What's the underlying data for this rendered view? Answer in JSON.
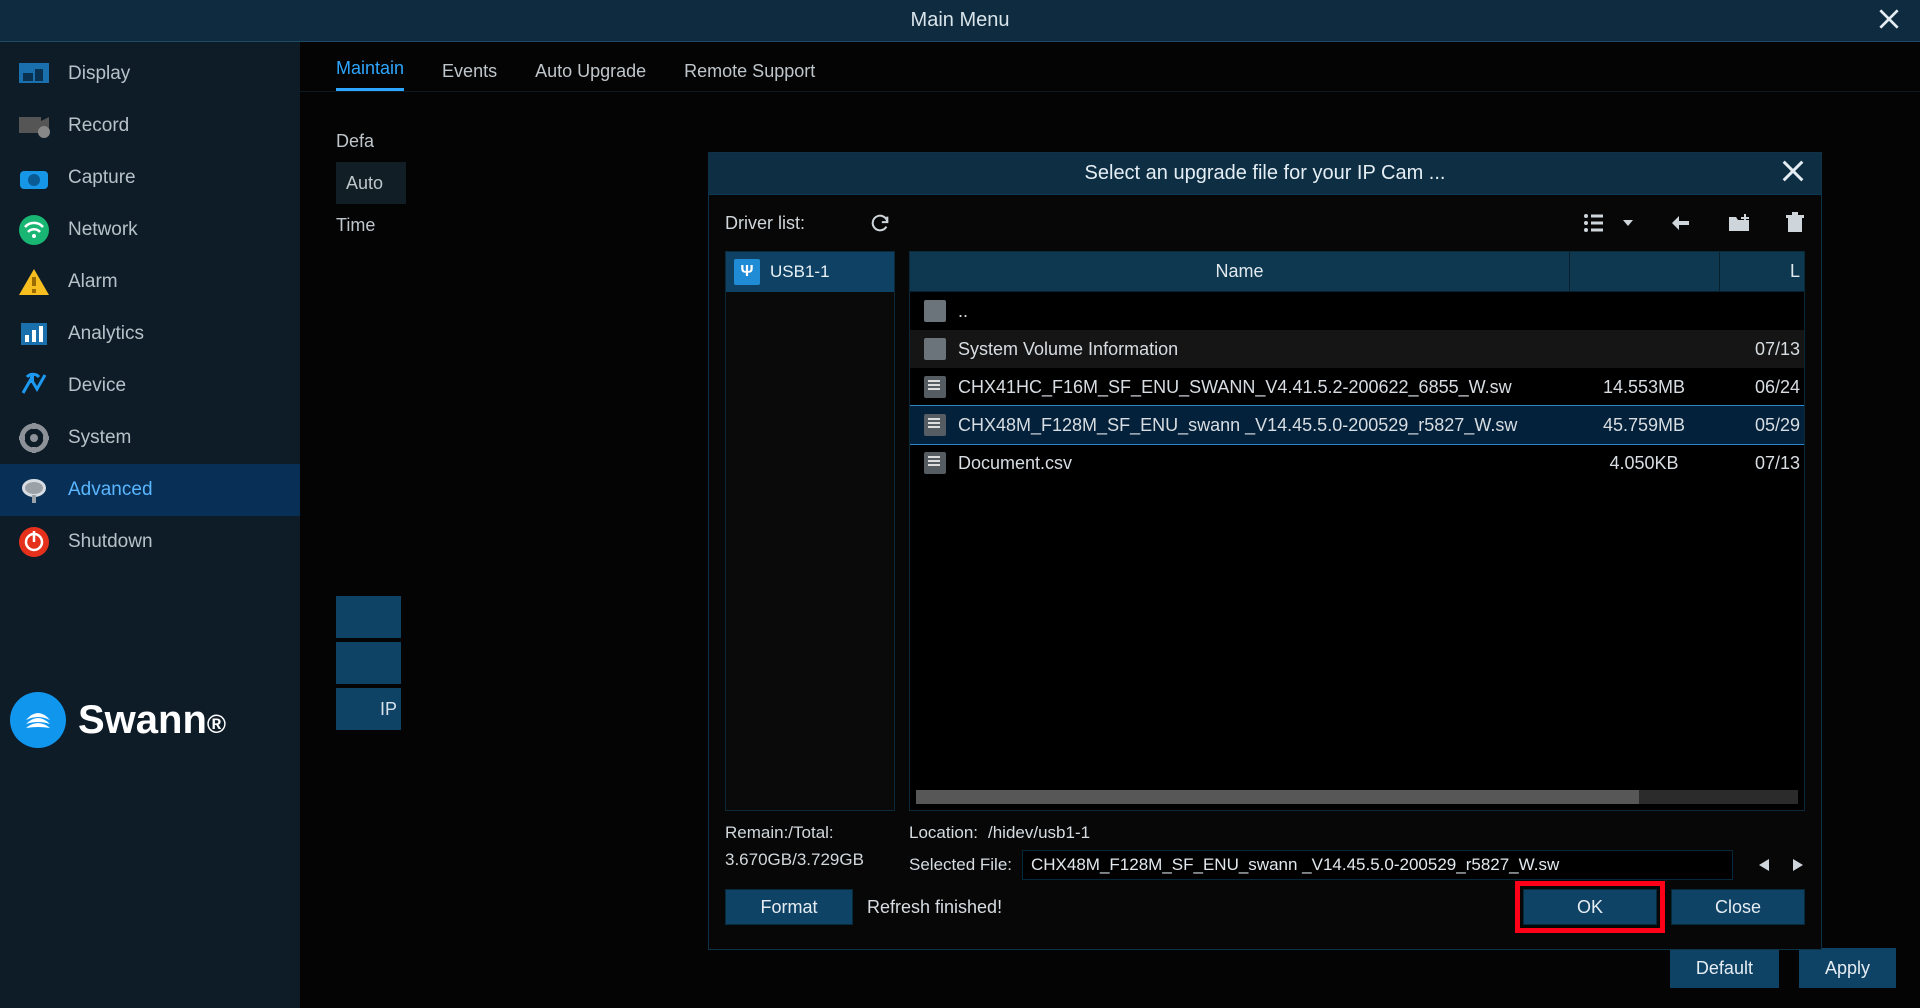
{
  "titlebar": {
    "title": "Main Menu"
  },
  "sidebar": {
    "items": [
      {
        "label": "Display"
      },
      {
        "label": "Record"
      },
      {
        "label": "Capture"
      },
      {
        "label": "Network"
      },
      {
        "label": "Alarm"
      },
      {
        "label": "Analytics"
      },
      {
        "label": "Device"
      },
      {
        "label": "System"
      },
      {
        "label": "Advanced"
      },
      {
        "label": "Shutdown"
      }
    ],
    "logo": "Swann"
  },
  "tabs": {
    "items": [
      {
        "label": "Maintain"
      },
      {
        "label": "Events"
      },
      {
        "label": "Auto Upgrade"
      },
      {
        "label": "Remote Support"
      }
    ]
  },
  "subrows": {
    "r0": "Defa",
    "r1": "Auto",
    "r2": "Time"
  },
  "vb": {
    "b2": "IP"
  },
  "bottom": {
    "default": "Default",
    "apply": "Apply"
  },
  "dialog": {
    "title": "Select an upgrade file for your IP Cam ...",
    "driver_label": "Driver list:",
    "drive": "USB1-1",
    "cols": {
      "name": "Name",
      "date_letter": "L"
    },
    "rows": [
      {
        "name": "..",
        "size": "",
        "date": "",
        "type": "folder"
      },
      {
        "name": "System Volume Information",
        "size": "",
        "date": "07/13",
        "type": "folder"
      },
      {
        "name": "CHX41HC_F16M_SF_ENU_SWANN_V4.41.5.2-200622_6855_W.sw",
        "size": "14.553MB",
        "date": "06/24",
        "type": "file"
      },
      {
        "name": "CHX48M_F128M_SF_ENU_swann _V14.45.5.0-200529_r5827_W.sw",
        "size": "45.759MB",
        "date": "05/29",
        "type": "file"
      },
      {
        "name": "Document.csv",
        "size": "4.050KB",
        "date": "07/13",
        "type": "file"
      }
    ],
    "location_label": "Location:",
    "location_value": "/hidev/usb1-1",
    "selected_label": "Selected File:",
    "selected_value": "CHX48M_F128M_SF_ENU_swann _V14.45.5.0-200529_r5827_W.sw",
    "remain_label": "Remain:/Total:",
    "remain_value": "3.670GB/3.729GB",
    "format": "Format",
    "status": "Refresh finished!",
    "ok": "OK",
    "close": "Close"
  }
}
